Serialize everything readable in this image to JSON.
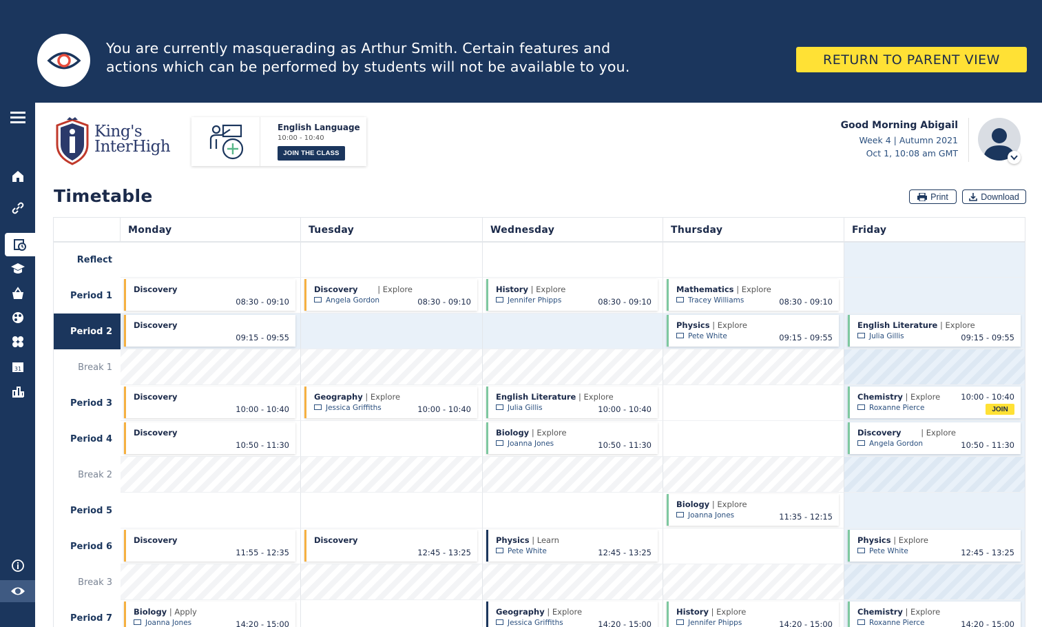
{
  "banner": {
    "line1": "You are currently masquerading as Arthur Smith. Certain features and",
    "line2": "actions which can be performed by students will not be available to you.",
    "return_label": "RETURN TO PARENT VIEW"
  },
  "logo": {
    "line1": "King's",
    "line2": "InterHigh"
  },
  "current_class": {
    "title": "English Language",
    "time": "10:00 - 10:40",
    "join_label": "JOIN THE CLASS"
  },
  "greeting": {
    "hello": "Good Morning Abigail",
    "week": "Week 4 | Autumn 2021",
    "datetime": "Oct 1, 10:08 am GMT"
  },
  "page": {
    "title": "Timetable",
    "print_label": "Print",
    "download_label": "Download"
  },
  "colors": {
    "navy": "#1b365d",
    "yellow": "#ffe135",
    "discovery": "#f5b041",
    "explore": "#7ec8a0"
  },
  "days": [
    "Monday",
    "Tuesday",
    "Wednesday",
    "Thursday",
    "Friday"
  ],
  "rows": [
    "Reflect",
    "Period 1",
    "Period 2",
    "Break 1",
    "Period 3",
    "Period 4",
    "Break 2",
    "Period 5",
    "Period 6",
    "Break 3",
    "Period 7"
  ],
  "lessons": [
    {
      "day": 0,
      "row": 1,
      "subject": "Discovery",
      "mode": "",
      "teacher": "",
      "time": "08:30 - 09:10",
      "kind": "discovery"
    },
    {
      "day": 1,
      "row": 1,
      "subject": "Discovery",
      "mode": "Explore",
      "teacher": "Angela Gordon",
      "time": "08:30 - 09:10",
      "kind": "discovery",
      "gap": true
    },
    {
      "day": 2,
      "row": 1,
      "subject": "History",
      "mode": "Explore",
      "teacher": "Jennifer Phipps",
      "time": "08:30 - 09:10",
      "kind": "explore"
    },
    {
      "day": 3,
      "row": 1,
      "subject": "Mathematics",
      "mode": "Explore",
      "teacher": "Tracey Williams",
      "time": "08:30 - 09:10",
      "kind": "explore"
    },
    {
      "day": 0,
      "row": 2,
      "subject": "Discovery",
      "mode": "",
      "teacher": "",
      "time": "09:15 - 09:55",
      "kind": "discovery"
    },
    {
      "day": 3,
      "row": 2,
      "subject": "Physics",
      "mode": "Explore",
      "teacher": "Pete White",
      "time": "09:15 - 09:55",
      "kind": "explore"
    },
    {
      "day": 4,
      "row": 2,
      "subject": "English Literature",
      "mode": "Explore",
      "teacher": "Julia Gillis",
      "time": "09:15 - 09:55",
      "kind": "explore"
    },
    {
      "day": 0,
      "row": 4,
      "subject": "Discovery",
      "mode": "",
      "teacher": "",
      "time": "10:00 - 10:40",
      "kind": "discovery"
    },
    {
      "day": 1,
      "row": 4,
      "subject": "Geography",
      "mode": "Explore",
      "teacher": "Jessica Griffiths",
      "time": "10:00 - 10:40",
      "kind": "discovery"
    },
    {
      "day": 2,
      "row": 4,
      "subject": "English Literature",
      "mode": "Explore",
      "teacher": "Julia Gillis",
      "time": "10:00 - 10:40",
      "kind": "explore"
    },
    {
      "day": 4,
      "row": 4,
      "subject": "Chemistry",
      "mode": "Explore",
      "teacher": "Roxanne Pierce",
      "time": "10:00 - 10:40",
      "kind": "explore",
      "join": "JOIN"
    },
    {
      "day": 0,
      "row": 5,
      "subject": "Discovery",
      "mode": "",
      "teacher": "",
      "time": "10:50 - 11:30",
      "kind": "discovery"
    },
    {
      "day": 2,
      "row": 5,
      "subject": "Biology",
      "mode": "Explore",
      "teacher": "Joanna Jones",
      "time": "10:50 - 11:30",
      "kind": "explore"
    },
    {
      "day": 4,
      "row": 5,
      "subject": "Discovery",
      "mode": "Explore",
      "teacher": "Angela Gordon",
      "time": "10:50 - 11:30",
      "kind": "explore",
      "gap": true
    },
    {
      "day": 3,
      "row": 7,
      "subject": "Biology",
      "mode": "Explore",
      "teacher": "Joanna Jones",
      "time": "11:35 - 12:15",
      "kind": "explore"
    },
    {
      "day": 0,
      "row": 8,
      "subject": "Discovery",
      "mode": "",
      "teacher": "",
      "time": "11:55 - 12:35",
      "kind": "discovery"
    },
    {
      "day": 1,
      "row": 8,
      "subject": "Discovery",
      "mode": "",
      "teacher": "",
      "time": "12:45 - 13:25",
      "kind": "discovery"
    },
    {
      "day": 2,
      "row": 8,
      "subject": "Physics",
      "mode": "Learn",
      "teacher": "Pete White",
      "time": "12:45 - 13:25",
      "kind": "learn"
    },
    {
      "day": 4,
      "row": 8,
      "subject": "Physics",
      "mode": "Explore",
      "teacher": "Pete White",
      "time": "12:45 - 13:25",
      "kind": "explore"
    },
    {
      "day": 0,
      "row": 10,
      "subject": "Biology",
      "mode": "Apply",
      "teacher": "Joanna Jones",
      "time": "14:20 - 15:00",
      "kind": "discovery"
    },
    {
      "day": 2,
      "row": 10,
      "subject": "Geography",
      "mode": "Explore",
      "teacher": "Jessica Griffiths",
      "time": "14:20 - 15:00",
      "kind": "learn"
    },
    {
      "day": 3,
      "row": 10,
      "subject": "History",
      "mode": "Explore",
      "teacher": "Jennifer Phipps",
      "time": "14:20 - 15:00",
      "kind": "explore"
    },
    {
      "day": 4,
      "row": 10,
      "subject": "Chemistry",
      "mode": "Explore",
      "teacher": "Roxanne Pierce",
      "time": "14:20 - 15:00",
      "kind": "explore"
    }
  ]
}
